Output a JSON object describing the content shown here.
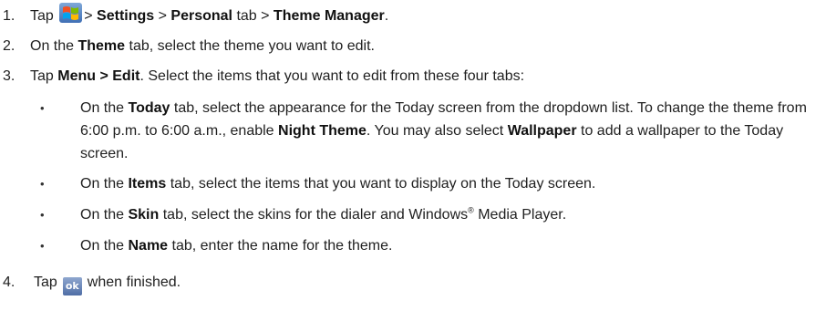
{
  "steps": {
    "s1": {
      "num": "1.",
      "t1": "Tap",
      "t2": "> ",
      "settings": "Settings",
      "t3": " > ",
      "personal": "Personal",
      "t4": " tab > ",
      "theme_manager": "Theme Manager",
      "t5": ".",
      "icon": "windows-start-icon"
    },
    "s2": {
      "num": "2.",
      "t1": "On the ",
      "theme": "Theme",
      "t2": " tab, select the theme you want to edit."
    },
    "s3": {
      "num": "3.",
      "t1": "Tap ",
      "menu_edit": "Menu > Edit",
      "t2": ". Select the items that you want to edit from these four tabs:"
    },
    "s4": {
      "num": "4.",
      "t1": "Tap",
      "t2": "when finished.",
      "icon_label": "ok"
    }
  },
  "bullets": {
    "symbol": "•",
    "b1": {
      "t1": "On the ",
      "today": "Today",
      "t2": " tab, select the appearance for the Today screen from the dropdown list. To change the theme from 6:00 p.m. to 6:00 a.m., enable ",
      "night_theme": "Night Theme",
      "t3": ". You may also select ",
      "wallpaper": "Wallpaper",
      "t4": " to add a wallpaper to the Today screen."
    },
    "b2": {
      "t1": "On the ",
      "items": "Items",
      "t2": " tab, select the items that you want to display on the Today screen."
    },
    "b3": {
      "t1": "On the ",
      "skin": "Skin",
      "t2": " tab, select the skins for the dialer and Windows",
      "reg": "®",
      "t3": " Media Player."
    },
    "b4": {
      "t1": "On the ",
      "name": "Name",
      "t2": " tab, enter the name for the theme."
    }
  }
}
